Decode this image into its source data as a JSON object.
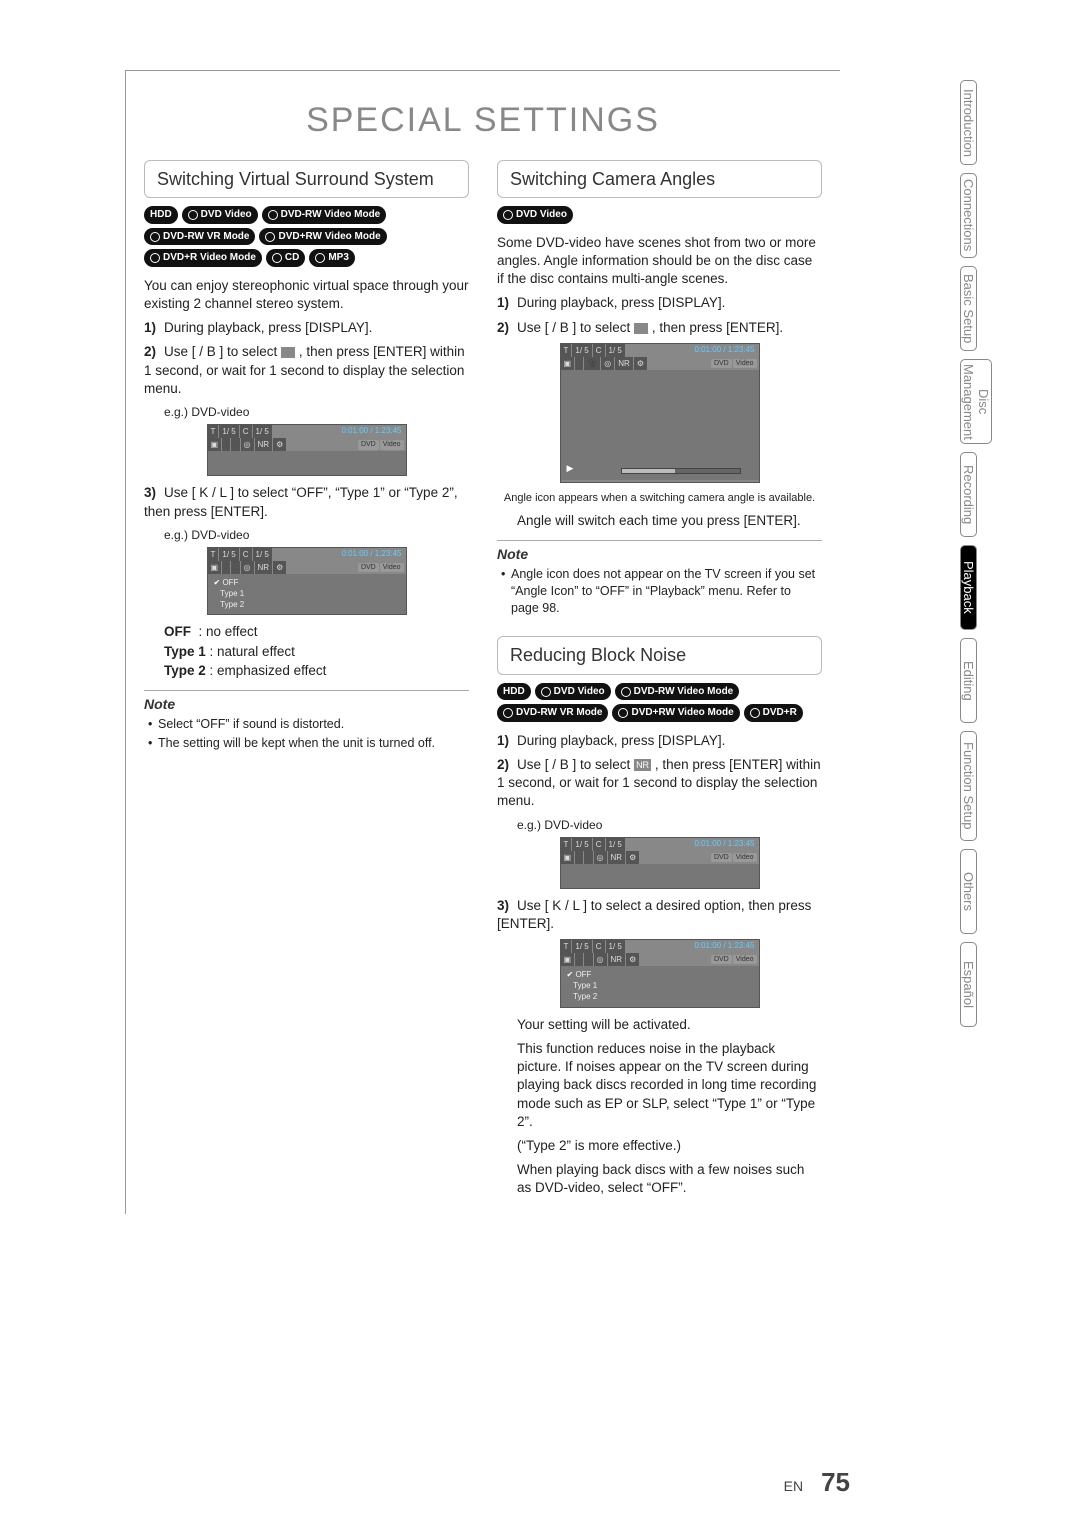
{
  "title": "SPECIAL SETTINGS",
  "tabs": [
    "Introduction",
    "Connections",
    "Basic Setup",
    "Disc\nManagement",
    "Recording",
    "Playback",
    "Editing",
    "Function Setup",
    "Others",
    "Español"
  ],
  "active_tab_index": 5,
  "page_lang": "EN",
  "page_number": "75",
  "left": {
    "heading": "Switching Virtual Surround System",
    "badges": [
      "HDD",
      "DVD Video",
      "DVD-RW Video Mode",
      "DVD-RW VR Mode",
      "DVD+RW Video Mode",
      "DVD+R Video Mode",
      "CD",
      "MP3"
    ],
    "intro": "You can enjoy stereophonic virtual space through your existing 2 channel stereo system.",
    "step1": "During playback, press [DISPLAY].",
    "step2_a": "Use [",
    "step2_b": " / B ] to select ",
    "step2_c": " , then press [ENTER] within 1 second, or wait for 1 second to display the selection menu.",
    "eg": "e.g.) DVD-video",
    "step3": "Use [ K / L ] to select “OFF”, “Type 1” or “Type 2”, then press [ENTER].",
    "defs": [
      [
        "OFF",
        ": no effect"
      ],
      [
        "Type 1",
        ": natural effect"
      ],
      [
        "Type 2",
        ": emphasized effect"
      ]
    ],
    "note_hd": "Note",
    "notes": [
      "Select “OFF” if sound is distorted.",
      "The setting will be kept when the unit is turned off."
    ]
  },
  "right_a": {
    "heading": "Switching Camera Angles",
    "badges": [
      "DVD Video"
    ],
    "intro": "Some DVD-video have scenes shot from two or more angles. Angle information should be on the disc case if the disc contains multi-angle scenes.",
    "step1": "During playback, press [DISPLAY].",
    "step2_a": "Use [",
    "step2_b": " / B ] to select ",
    "step2_c": " , then press [ENTER].",
    "caption": "Angle icon appears when a switching camera angle is available.",
    "after": "Angle will switch each time you press [ENTER].",
    "note_hd": "Note",
    "notes": [
      "Angle icon does not appear on the TV screen if you set “Angle Icon” to “OFF” in “Playback” menu. Refer to page 98."
    ]
  },
  "right_b": {
    "heading": "Reducing Block Noise",
    "badges": [
      "HDD",
      "DVD Video",
      "DVD-RW Video Mode",
      "DVD-RW VR Mode",
      "DVD+RW Video Mode",
      "DVD+R"
    ],
    "step1": "During playback, press [DISPLAY].",
    "step2_a": "Use [",
    "step2_b": " / B ] to select ",
    "step2_c": " , then press [ENTER] within 1 second, or wait for 1 second to display the selection menu.",
    "eg": "e.g.) DVD-video",
    "step3": "Use [ K / L ] to select a desired option, then press [ENTER].",
    "after1": "Your setting will be activated.",
    "after2": "This function reduces noise in the playback picture. If noises appear on the TV screen during playing back discs recorded in long time recording mode such as EP or SLP, select “Type 1” or “Type 2”.",
    "after3": "(“Type 2” is more effective.)",
    "after4": "When playing back discs with a few noises such as DVD-video, select “OFF”."
  },
  "osd": {
    "t_label": "T",
    "t_val": "1/  5",
    "c_label": "C",
    "c_val": "1/  5",
    "time": "0:01:00 / 1:23:45",
    "badge1": "DVD",
    "badge2": "Video",
    "nr": "NR",
    "menu": [
      "OFF",
      "Type 1",
      "Type 2"
    ]
  }
}
